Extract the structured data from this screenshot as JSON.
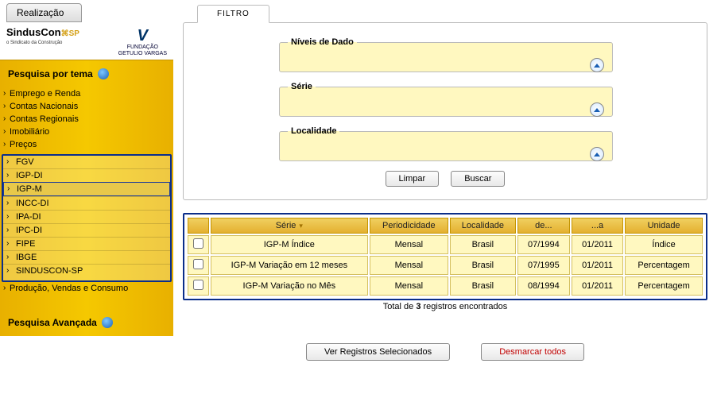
{
  "sidebar": {
    "realizacao_tab": "Realização",
    "logo_sindus": {
      "main": "SindusCon",
      "sp": "SP",
      "sub": "o Sindicato da Construção"
    },
    "logo_fgv": {
      "line1": "FUNDAÇÃO",
      "line2": "GETULIO VARGAS"
    },
    "pesquisa_tema": "Pesquisa por tema",
    "items": [
      "Emprego e Renda",
      "Contas Nacionais",
      "Contas Regionais",
      "Imobiliário",
      "Preços"
    ],
    "sub_items": [
      "FGV",
      "IGP-DI",
      "IGP-M",
      "INCC-DI",
      "IPA-DI",
      "IPC-DI",
      "FIPE",
      "IBGE",
      "SINDUSCON-SP"
    ],
    "items_after": [
      "Produção, Vendas e Consumo"
    ],
    "pesquisa_avancada": "Pesquisa Avançada"
  },
  "filter": {
    "tab": "FILTRO",
    "niveis": "Níveis de Dado",
    "serie": "Série",
    "localidade": "Localidade",
    "limpar": "Limpar",
    "buscar": "Buscar"
  },
  "table": {
    "headers": [
      "",
      "Série",
      "Periodicidade",
      "Localidade",
      "de...",
      "...a",
      "Unidade"
    ],
    "rows": [
      {
        "serie": "IGP-M Índice",
        "period": "Mensal",
        "loc": "Brasil",
        "de": "07/1994",
        "a": "01/2011",
        "unidade": "Índice"
      },
      {
        "serie": "IGP-M Variação em 12 meses",
        "period": "Mensal",
        "loc": "Brasil",
        "de": "07/1995",
        "a": "01/2011",
        "unidade": "Percentagem"
      },
      {
        "serie": "IGP-M Variação no Mês",
        "period": "Mensal",
        "loc": "Brasil",
        "de": "08/1994",
        "a": "01/2011",
        "unidade": "Percentagem"
      }
    ],
    "total_prefix": "Total de ",
    "total_count": "3",
    "total_suffix": " registros encontrados"
  },
  "buttons": {
    "ver": "Ver Registros Selecionados",
    "desmarcar": "Desmarcar todos"
  }
}
